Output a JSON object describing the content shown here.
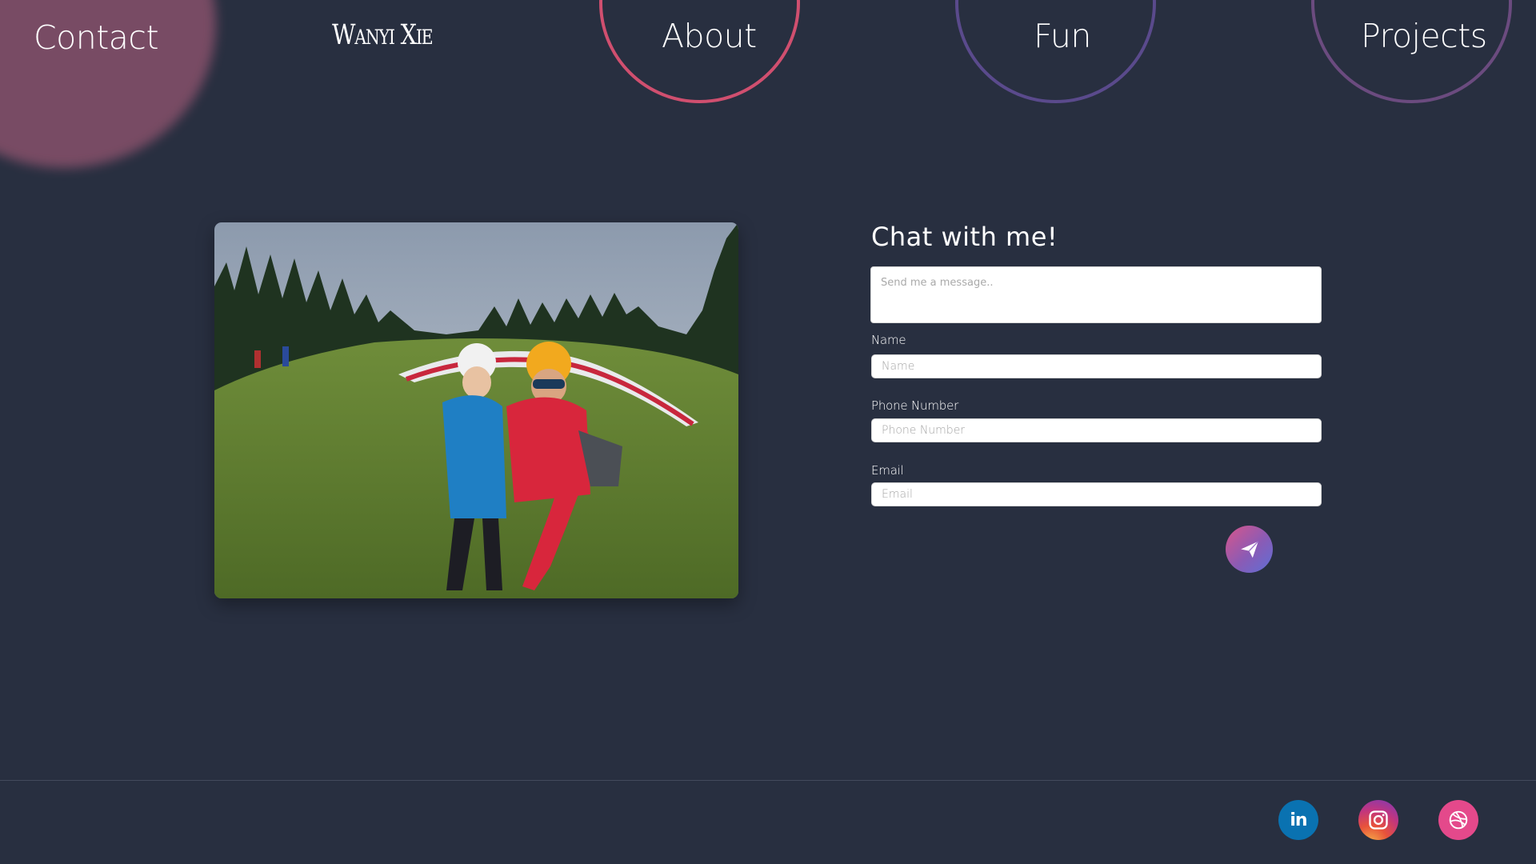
{
  "nav": {
    "contact": "Contact",
    "brand": "Wanyi Xie",
    "about": "About",
    "fun": "Fun",
    "projects": "Projects"
  },
  "colors": {
    "background": "#282f40",
    "blob": "#7d4d66",
    "ring_about": "#d04f6f",
    "ring_fun": "#5a4a8c",
    "ring_projects": "#6b4b7f"
  },
  "form": {
    "title": "Chat with me!",
    "message_placeholder": "Send me a message..",
    "name_label": "Name",
    "name_placeholder": "Name",
    "phone_label": "Phone Number",
    "phone_placeholder": "Phone Number",
    "email_label": "Email",
    "email_placeholder": "Email",
    "send_icon": "paper-plane-icon"
  },
  "footer": {
    "social": [
      {
        "icon": "linkedin-icon",
        "text": "in"
      },
      {
        "icon": "instagram-icon"
      },
      {
        "icon": "dribbble-icon"
      }
    ]
  }
}
